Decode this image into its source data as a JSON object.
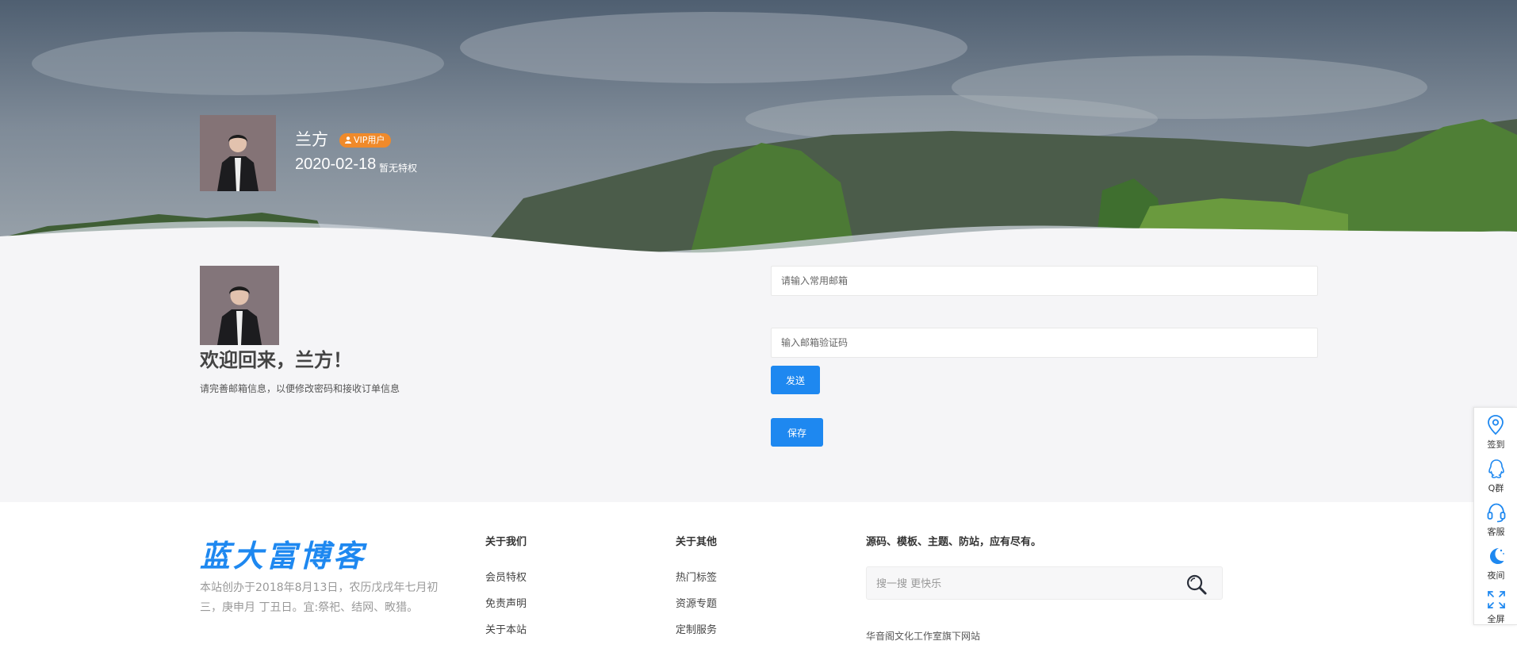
{
  "profile": {
    "name": "兰方",
    "vip_label": "VIP用户",
    "date": "2020-02-18",
    "privilege": "暂无特权"
  },
  "main": {
    "welcome": "欢迎回来，兰方！",
    "subtitle": "请完善邮箱信息，以便修改密码和接收订单信息",
    "email_placeholder": "请输入常用邮箱",
    "code_placeholder": "输入邮箱验证码",
    "send_label": "发送",
    "save_label": "保存"
  },
  "footer": {
    "logo": "蓝大富博客",
    "description": "本站创办于2018年8月13日，农历戊戌年七月初三，庚申月 丁丑日。宜:祭祀、结网、畋猎。",
    "about_us": {
      "title": "关于我们",
      "links": [
        "会员特权",
        "免责声明",
        "关于本站"
      ]
    },
    "about_other": {
      "title": "关于其他",
      "links": [
        "热门标签",
        "资源专题",
        "定制服务"
      ]
    },
    "slogan": "源码、模板、主题、防站，应有尽有。",
    "search_placeholder": "搜一搜 更快乐",
    "studio": "华音阁文化工作室旗下网站"
  },
  "sidebar": {
    "items": [
      {
        "label": "签到",
        "icon": "location-pin-icon"
      },
      {
        "label": "Q群",
        "icon": "qq-icon"
      },
      {
        "label": "客服",
        "icon": "headset-icon"
      },
      {
        "label": "夜间",
        "icon": "moon-icon"
      },
      {
        "label": "全屏",
        "icon": "fullscreen-icon"
      }
    ]
  },
  "colors": {
    "accent": "#1e88f0",
    "vip": "#f08a2a",
    "page_bg": "#f5f5f7"
  }
}
